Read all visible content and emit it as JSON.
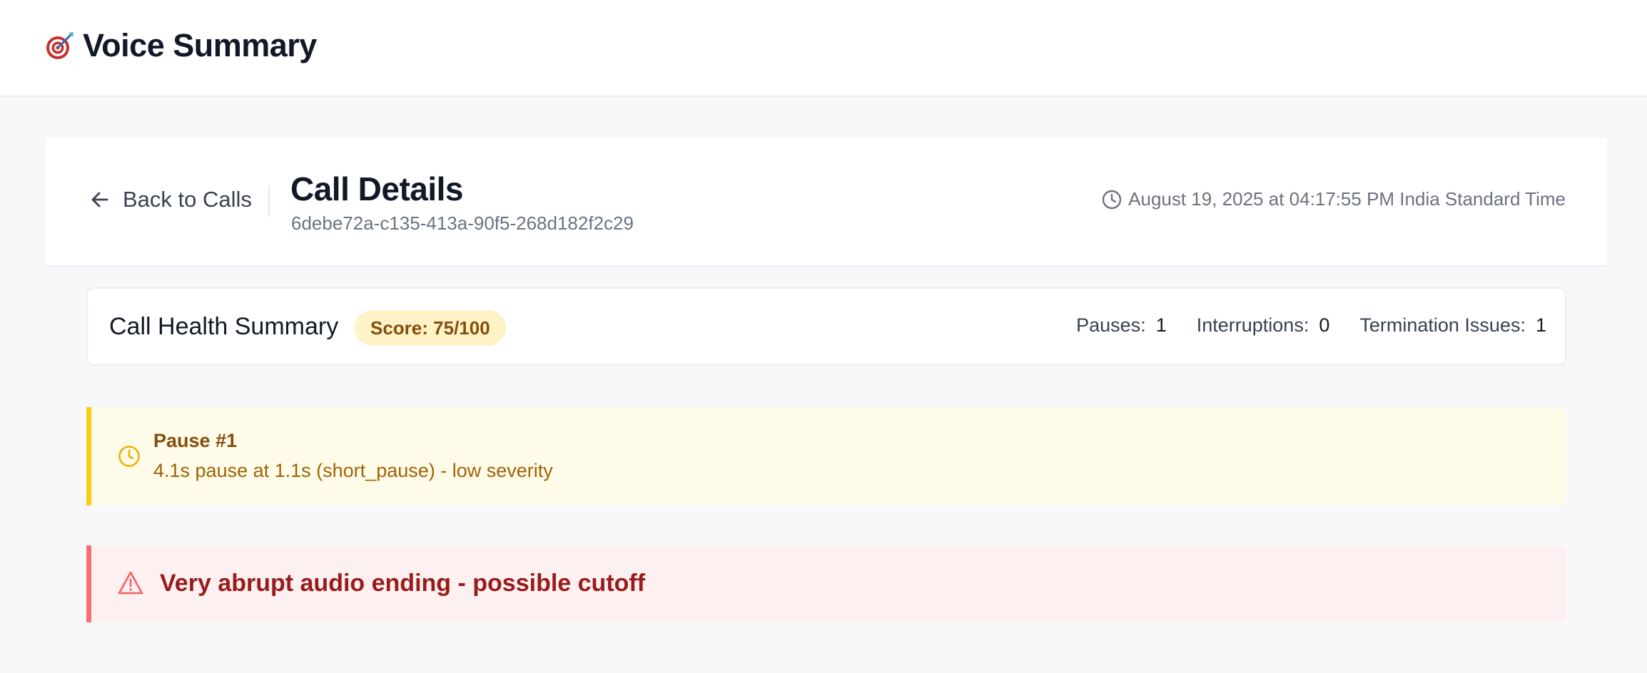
{
  "app": {
    "title": "Voice Summary",
    "logo_icon": "target-dart-icon"
  },
  "header": {
    "back_label": "Back to Calls",
    "title": "Call Details",
    "call_id": "6debe72a-c135-413a-90f5-268d182f2c29",
    "timestamp": "August 19, 2025 at 04:17:55 PM India Standard Time"
  },
  "health": {
    "title": "Call Health Summary",
    "score_label": "Score: 75/100",
    "score": 75,
    "score_max": 100,
    "stats": [
      {
        "label": "Pauses:",
        "value": "1"
      },
      {
        "label": "Interruptions:",
        "value": "0"
      },
      {
        "label": "Termination Issues:",
        "value": "1"
      }
    ]
  },
  "pause_card": {
    "title": "Pause #1",
    "description": "4.1s pause at 1.1s (short_pause) - low severity",
    "icon": "clock-icon",
    "accent": "#facc15"
  },
  "alert_card": {
    "message": "Very abrupt audio ending - possible cutoff",
    "icon": "warning-triangle-icon",
    "accent": "#f87171"
  }
}
